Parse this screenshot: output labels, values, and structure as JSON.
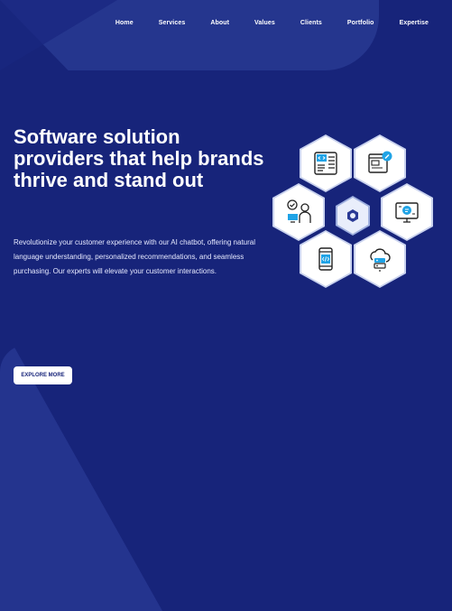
{
  "nav": {
    "items": [
      "Home",
      "Services",
      "About",
      "Values",
      "Clients",
      "Portfolio",
      "Expertise"
    ]
  },
  "hero": {
    "title": "Software solution providers that help brands thrive and stand out",
    "description": "Revolutionize your customer experience with our AI chatbot, offering natural language understanding, personalized recommendations, and seamless purchasing. Our experts will elevate your customer interactions.",
    "cta_label": "EXPLORE MORE"
  },
  "icons": [
    "code-editor-icon",
    "browser-edit-icon",
    "developer-person-icon",
    "center-logo-icon",
    "monitor-chat-icon",
    "mobile-code-icon",
    "cloud-server-icon"
  ],
  "colors": {
    "background": "#17247a",
    "accent": "#2a3a95",
    "icon_blue": "#1fa3e6"
  }
}
